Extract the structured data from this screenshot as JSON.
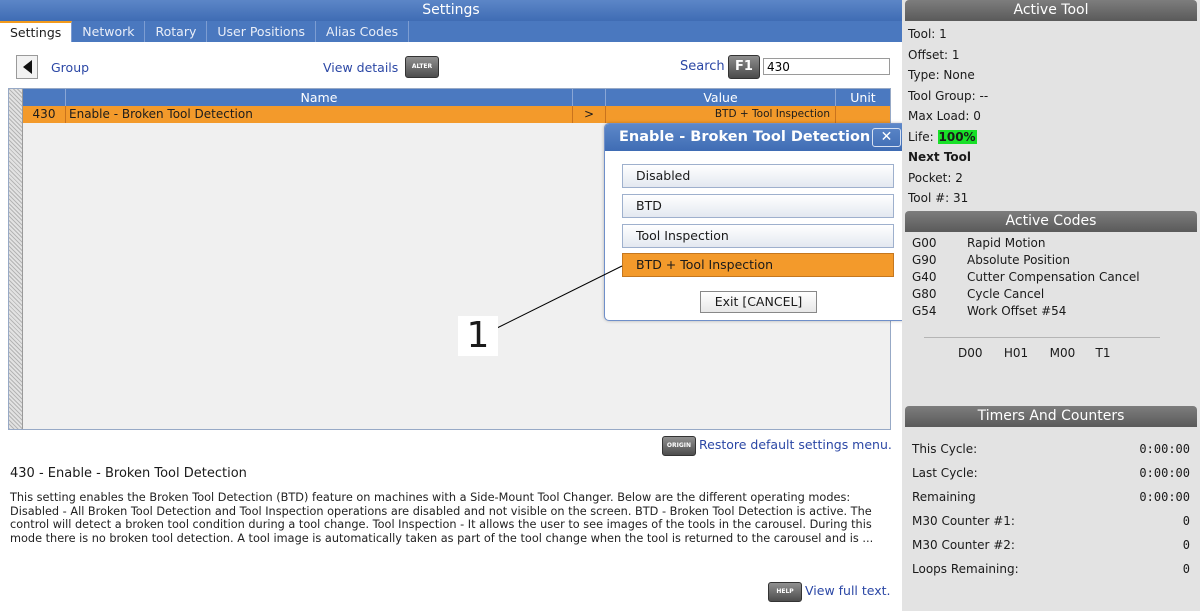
{
  "settings": {
    "title": "Settings",
    "tabs": [
      "Settings",
      "Network",
      "Rotary",
      "User Positions",
      "Alias Codes"
    ],
    "group_label": "Group",
    "view_details_label": "View details",
    "alter_key_label": "ALTER",
    "search_label": "Search",
    "f1_key_label": "F1",
    "search_value": "430",
    "columns": {
      "name": "Name",
      "value": "Value",
      "unit": "Unit"
    },
    "row": {
      "number": "430",
      "name": "Enable - Broken Tool Detection",
      "arrow": ">",
      "value": "BTD + Tool Inspection",
      "unit": ""
    },
    "origin_key_label": "ORIGIN",
    "restore_label": "Restore default settings menu.",
    "desc_title": "430 - Enable - Broken Tool Detection",
    "desc_text": "This setting enables the Broken Tool Detection (BTD) feature on machines with a Side-Mount Tool Changer. Below are the different operating modes: Disabled - All Broken Tool Detection and Tool Inspection operations are disabled and not visible on the screen. BTD - Broken Tool Detection is active. The control will detect a broken tool condition during a tool change. Tool Inspection - It allows the user to see images of the tools in the carousel. During this mode there is no broken tool detection. A tool image is automatically taken as part of the tool change when the tool is returned to the carousel and is ...",
    "help_key_label": "HELP",
    "view_full_label": "View full text."
  },
  "popup": {
    "title": "Enable - Broken Tool Detection",
    "close_label": "✕",
    "options": [
      "Disabled",
      "BTD",
      "Tool Inspection",
      "BTD + Tool Inspection"
    ],
    "selected": "BTD + Tool Inspection",
    "exit_label": "Exit [CANCEL]"
  },
  "callout": {
    "number": "1"
  },
  "active_tool": {
    "title": "Active Tool",
    "tool": "Tool: 1",
    "offset": "Offset: 1",
    "type": "Type: None",
    "tool_group": "Tool Group: --",
    "max_load": "Max Load: 0",
    "life_label": "Life:",
    "life_value": "100%",
    "next_tool_label": "Next Tool",
    "pocket": "Pocket: 2",
    "tool_number": "Tool #: 31"
  },
  "active_codes": {
    "title": "Active Codes",
    "codes": [
      {
        "code": "G00",
        "desc": "Rapid Motion"
      },
      {
        "code": "G90",
        "desc": "Absolute Position"
      },
      {
        "code": "G40",
        "desc": "Cutter Compensation Cancel"
      },
      {
        "code": "G80",
        "desc": "Cycle Cancel"
      },
      {
        "code": "G54",
        "desc": "Work Offset #54"
      }
    ],
    "d": "D00",
    "h": "H01",
    "m": "M00",
    "t": "T1"
  },
  "timers": {
    "title": "Timers And Counters",
    "rows": [
      {
        "label": "This Cycle:",
        "value": "0:00:00"
      },
      {
        "label": "Last Cycle:",
        "value": "0:00:00"
      },
      {
        "label": "Remaining",
        "value": "0:00:00"
      },
      {
        "label": "M30 Counter #1:",
        "value": "0"
      },
      {
        "label": "M30 Counter #2:",
        "value": "0"
      },
      {
        "label": "Loops Remaining:",
        "value": "0"
      }
    ]
  }
}
